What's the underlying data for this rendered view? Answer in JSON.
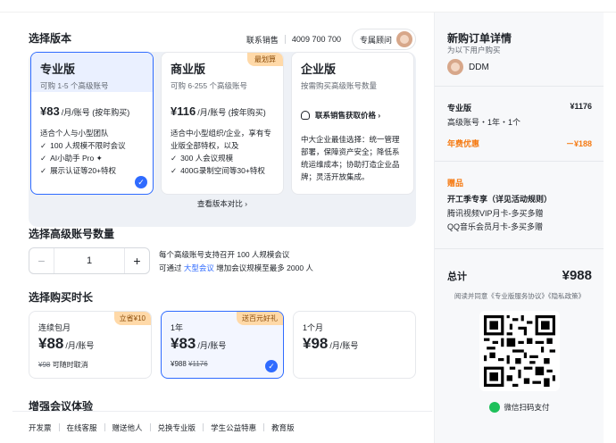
{
  "main": {
    "title": "选择版本",
    "sales_label": "联系销售",
    "sales_phone": "4009 700 700",
    "advisor_label": "专属顾问",
    "plans": [
      {
        "name": "专业版",
        "sub": "可购 1-5 个高级账号",
        "price": "¥83",
        "unit": "/月/账号 (按年购买)",
        "desc_intro": "适合个人与小型团队",
        "features": [
          "100 人规模不限时会议",
          "AI小助手 Pro ✦",
          "展示认证等20+特权"
        ],
        "badge": ""
      },
      {
        "name": "商业版",
        "sub": "可购 6-255 个高级账号",
        "price": "¥116",
        "unit": "/月/账号 (按年购买)",
        "desc_intro": "适合中小型组织/企业，享有专业版全部特权，以及",
        "features": [
          "300 人会议规模",
          "400G录制空间等30+特权"
        ],
        "badge": "最划算"
      },
      {
        "name": "企业版",
        "sub": "按需购买高级账号数量",
        "contact": "联系销售获取价格 ›",
        "desc_intro": "中大企业最佳选择：统一管理部署，保障资产安全；降低系统运维成本；协助打造企业品牌；灵活开放集成。"
      }
    ],
    "compare_label": "查看版本对比 ›",
    "accounts_title": "选择高级账号数量",
    "quantity": "1",
    "accounts_note_1": "每个高级账号支持召开 100 人规模会议",
    "accounts_note_2a": "可通过",
    "accounts_note_link": "大型会议",
    "accounts_note_2b": "增加会议规模至最多 2000 人",
    "duration_title": "选择购买时长",
    "durations": [
      {
        "name": "连续包月",
        "price": "¥88",
        "unit": "/月/账号",
        "foot_strike": "¥98",
        "foot_extra": "可随时取消",
        "badge": "立省¥10"
      },
      {
        "name": "1年",
        "price": "¥83",
        "unit": "/月/账号",
        "foot_main": "¥988",
        "foot_strike": "¥1176",
        "badge": "送百元好礼"
      },
      {
        "name": "1个月",
        "price": "¥98",
        "unit": "/月/账号"
      }
    ],
    "cutoff_title": "增强会议体验",
    "footer_links": [
      "开发票",
      "在线客服",
      "赠送他人",
      "兑换专业版",
      "学生公益特惠",
      "教育版"
    ]
  },
  "side": {
    "title": "新购订单详情",
    "sub": "为以下用户购买",
    "user": "DDM",
    "item_name": "专业版",
    "item_price": "¥1176",
    "item_detail": "高级账号・1年・1个",
    "discount_label": "年费优惠",
    "discount_value": "－¥188",
    "gift_title": "赠品",
    "gift_headline": "开工季专享（详见活动规则）",
    "gift_1": "腾讯视频VIP月卡-多买多赠",
    "gift_2": "QQ音乐会员月卡-多买多赠",
    "total_label": "总计",
    "total_value": "¥988",
    "agreement": "阅读并同意《专业版服务协议》《隐私政策》",
    "pay_label": "微信扫码支付"
  }
}
